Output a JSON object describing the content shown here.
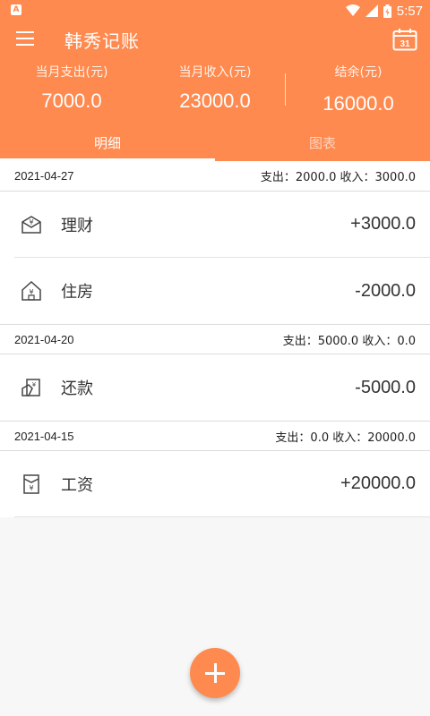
{
  "status_bar": {
    "time": "5:57",
    "left_icon": "A"
  },
  "app": {
    "title": "韩秀记账",
    "menu_icon": "menu-icon",
    "calendar_icon": "calendar-icon",
    "calendar_day": "31"
  },
  "summary": {
    "expense_label": "当月支出(元)",
    "expense_value": "7000.0",
    "income_label": "当月收入(元)",
    "income_value": "23000.0",
    "balance_label": "结余(元)",
    "balance_value": "16000.0"
  },
  "tabs": [
    {
      "label": "明细",
      "active": true
    },
    {
      "label": "图表",
      "active": false
    }
  ],
  "groups": [
    {
      "date": "2021-04-27",
      "summary": "支出：2000.0 收入：3000.0",
      "items": [
        {
          "name": "理财",
          "amount": "+3000.0",
          "icon": "finance-icon"
        },
        {
          "name": "住房",
          "amount": "-2000.0",
          "icon": "house-icon"
        }
      ]
    },
    {
      "date": "2021-04-20",
      "summary": "支出：5000.0 收入：0.0",
      "items": [
        {
          "name": "还款",
          "amount": "-5000.0",
          "icon": "repayment-icon"
        }
      ]
    },
    {
      "date": "2021-04-15",
      "summary": "支出：0.0 收入：20000.0",
      "items": [
        {
          "name": "工资",
          "amount": "+20000.0",
          "icon": "salary-icon"
        }
      ]
    }
  ],
  "colors": {
    "accent": "#ff8a4f",
    "background": "#f7f7f7"
  },
  "fab_icon": "plus-icon"
}
